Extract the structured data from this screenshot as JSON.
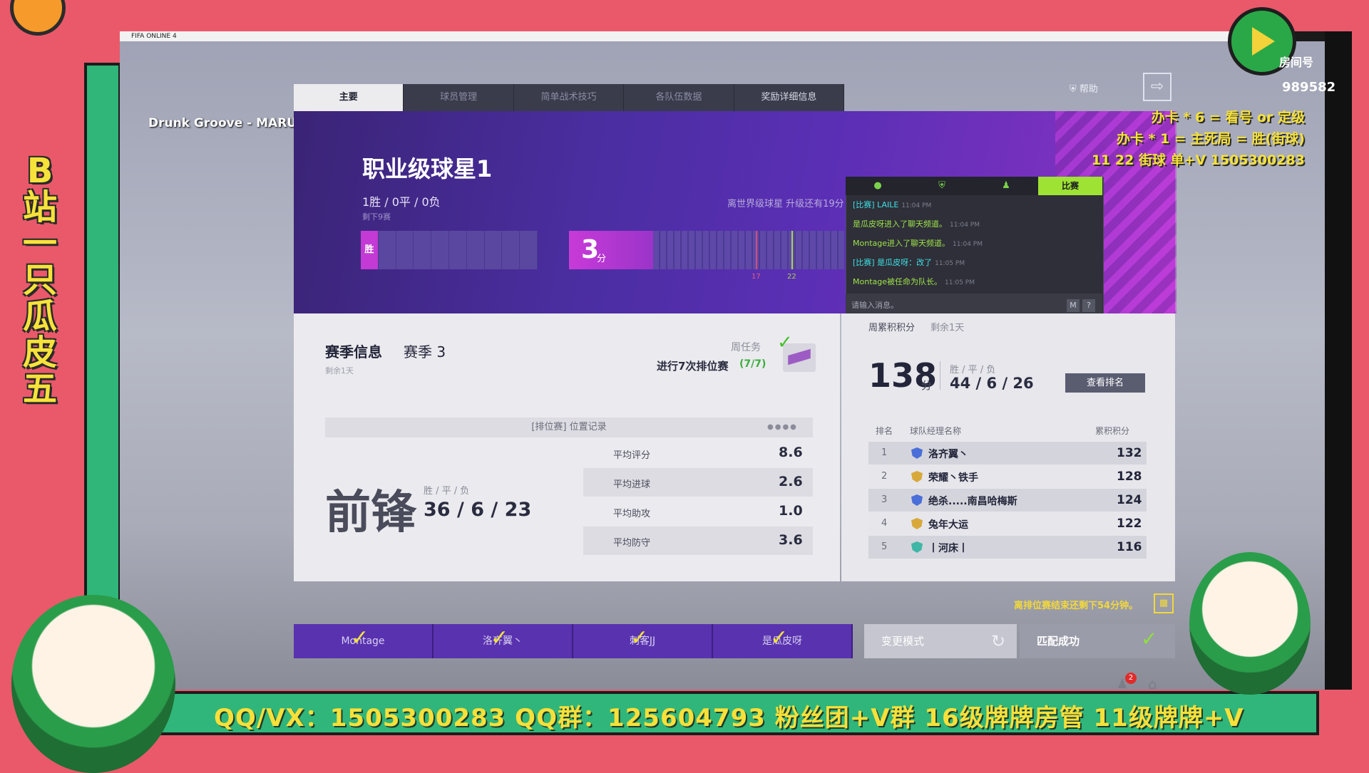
{
  "stream": {
    "vertical_tag": "B站一只瓜皮五",
    "banner": "QQ/VX：1505300283 QQ群：125604793 粉丝团+V群 16级牌牌房管 11级牌牌+V",
    "room_label": "房间号",
    "room_number": "989582",
    "promo_lines": [
      "办卡 * 6 = 看号 or 定级",
      "办卡 * 1 = 主死局 = 胜(街球)",
      "11 22 街球 单+V 1505300283"
    ],
    "song": "Drunk Groove - MARUV/BOOSIN"
  },
  "window": {
    "title": "FIFA ONLINE 4"
  },
  "tabs": [
    {
      "label": "主要",
      "active": true
    },
    {
      "label": "球员管理"
    },
    {
      "label": "简单战术技巧"
    },
    {
      "label": "各队伍数据"
    },
    {
      "label": "奖励详细信息"
    }
  ],
  "header": {
    "help": "帮助"
  },
  "hero": {
    "rank_title": "职业级球星1",
    "record": "1胜 / 0平 / 0负",
    "remaining_games": "剩下9赛",
    "promo_text": "离世界级球星 升级还有19分",
    "win_label": "胜",
    "score": "3",
    "score_unit": "分",
    "mark_17": "17",
    "mark_22": "22"
  },
  "chat": {
    "tab_match": "比赛",
    "lines": [
      {
        "text": "[比赛] LAILE",
        "time": "11:04 PM",
        "cls": "cyan"
      },
      {
        "text": "是瓜皮呀进入了聊天频道。",
        "time": "11:04 PM",
        "cls": ""
      },
      {
        "text": "Montage进入了聊天频道。",
        "time": "11:04 PM",
        "cls": ""
      },
      {
        "text": "[比赛] 是瓜皮呀：改了",
        "time": "11:05 PM",
        "cls": "cyan"
      },
      {
        "text": "Montage被任命为队长。",
        "time": "11:05 PM",
        "cls": ""
      }
    ],
    "input_placeholder": "请输入消息。",
    "btn_m": "M",
    "btn_q": "?"
  },
  "season": {
    "title": "赛季信息",
    "sub": "赛季 3",
    "remain": "剩余1天",
    "weekly_label": "周任务",
    "weekly_task": "进行7次排位赛",
    "weekly_progress": "(7/7)",
    "position_header": "[排位赛] 位置记录",
    "position": "前锋",
    "wdl_label": "胜 / 平 / 负",
    "wdl": "36 / 6 / 23",
    "stats": [
      {
        "label": "平均评分",
        "value": "8.6"
      },
      {
        "label": "平均进球",
        "value": "2.6"
      },
      {
        "label": "平均助攻",
        "value": "1.0"
      },
      {
        "label": "平均防守",
        "value": "3.6"
      }
    ]
  },
  "weekly_points": {
    "label": "周累积积分",
    "remain": "剩余1天",
    "points": "138",
    "unit": "分",
    "wdl_label": "胜 / 平 / 负",
    "wdl": "44 / 6 / 26",
    "rank_button": "查看排名",
    "headers": {
      "rank": "排名",
      "name": "球队经理名称",
      "points": "累积积分"
    },
    "rows": [
      {
        "rank": "1",
        "name": "洛齐翼丶",
        "points": "132",
        "badge": "#4a6fd8"
      },
      {
        "rank": "2",
        "name": "荣耀丶铁手",
        "points": "128",
        "badge": "#d8a93a"
      },
      {
        "rank": "3",
        "name": "绝杀.....南昌哈梅斯",
        "points": "124",
        "badge": "#4a6fd8"
      },
      {
        "rank": "4",
        "name": "兔年大运",
        "points": "122",
        "badge": "#d8a93a"
      },
      {
        "rank": "5",
        "name": "丨河床丨",
        "points": "116",
        "badge": "#3fb6a6"
      }
    ]
  },
  "bottom": {
    "remain_notice": "离排位赛结束还剩下54分钟。",
    "players": [
      "Montage",
      "洛齐翼丶",
      "刺客JJ",
      "是瓜皮呀"
    ],
    "mode_button": "变更模式",
    "match_button": "匹配成功",
    "notification_count": "2"
  }
}
